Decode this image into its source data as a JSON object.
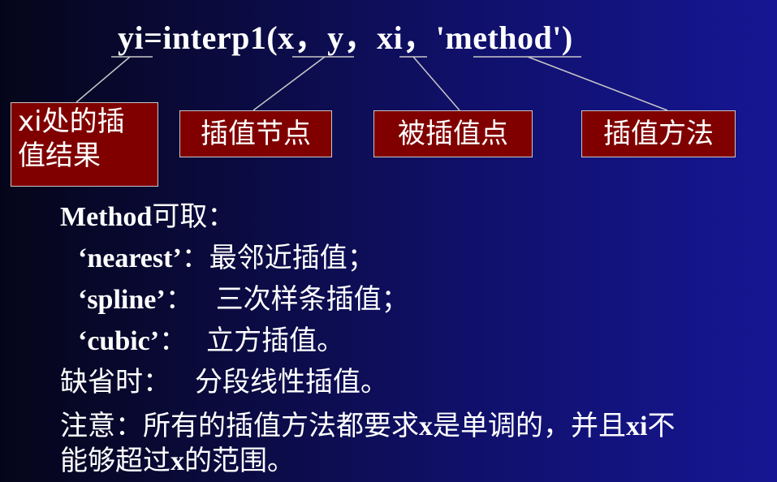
{
  "formula": {
    "prefix": "yi",
    "func": "=interp1(",
    "arg_x": "x",
    "sep1": "，",
    "arg_y": "y",
    "sep2": "，",
    "arg_xi": "xi",
    "sep3": "，",
    "arg_method": "'method'",
    "close": ")"
  },
  "boxes": {
    "result_line1": "xi处的插",
    "result_line2": "值结果",
    "nodes": "插值节点",
    "points": "被插值点",
    "method": "插值方法"
  },
  "body": {
    "method_label": "Method",
    "method_suffix": "可取：",
    "nearest_key": "‘nearest’",
    "nearest_sep": "：",
    "nearest_desc": "最邻近插值；",
    "spline_key": "‘spline’",
    "spline_sep": "：",
    "spline_desc": "三次样条插值；",
    "cubic_key": "‘cubic’",
    "cubic_sep": "：",
    "cubic_desc": "立方插值。",
    "default_label": "缺省时：",
    "default_desc": "分段线性插值。",
    "note_a": "注意：所有的插值方法都要求",
    "note_x1": "x",
    "note_b": "是单调的，并且",
    "note_xi": "xi",
    "note_c": "不",
    "note_d": "能够超过",
    "note_x2": "x",
    "note_e": "的范围。"
  },
  "colors": {
    "box_fill": "#800000",
    "box_border": "#c8c8c8",
    "text": "#ffffff",
    "background_dark": "#05051a",
    "background_light": "#161694"
  }
}
